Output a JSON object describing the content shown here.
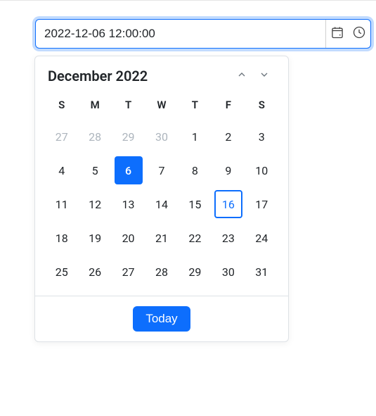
{
  "input": {
    "value": "2022-12-06 12:00:00"
  },
  "calendar": {
    "title": "December 2022",
    "weekdays": [
      "S",
      "M",
      "T",
      "W",
      "T",
      "F",
      "S"
    ],
    "days": [
      {
        "n": "27",
        "other": true
      },
      {
        "n": "28",
        "other": true
      },
      {
        "n": "29",
        "other": true
      },
      {
        "n": "30",
        "other": true
      },
      {
        "n": "1"
      },
      {
        "n": "2"
      },
      {
        "n": "3"
      },
      {
        "n": "4"
      },
      {
        "n": "5"
      },
      {
        "n": "6",
        "selected": true
      },
      {
        "n": "7"
      },
      {
        "n": "8"
      },
      {
        "n": "9"
      },
      {
        "n": "10"
      },
      {
        "n": "11"
      },
      {
        "n": "12"
      },
      {
        "n": "13"
      },
      {
        "n": "14"
      },
      {
        "n": "15"
      },
      {
        "n": "16",
        "today": true
      },
      {
        "n": "17"
      },
      {
        "n": "18"
      },
      {
        "n": "19"
      },
      {
        "n": "20"
      },
      {
        "n": "21"
      },
      {
        "n": "22"
      },
      {
        "n": "23"
      },
      {
        "n": "24"
      },
      {
        "n": "25"
      },
      {
        "n": "26"
      },
      {
        "n": "27"
      },
      {
        "n": "28"
      },
      {
        "n": "29"
      },
      {
        "n": "30"
      },
      {
        "n": "31"
      }
    ],
    "today_label": "Today"
  }
}
